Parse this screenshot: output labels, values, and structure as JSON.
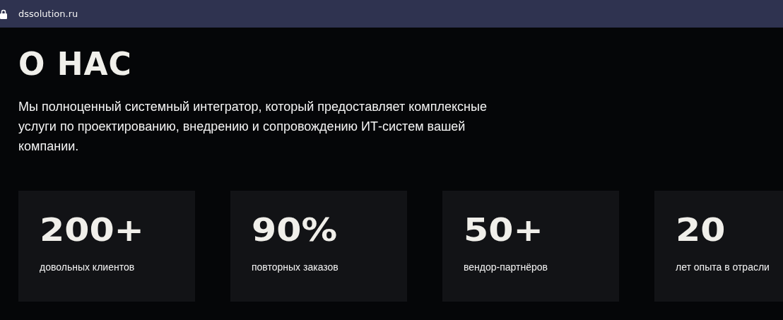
{
  "address_bar": {
    "url": "dssolution.ru"
  },
  "heading": "О НАС",
  "description": "Мы полноценный системный интегратор, который предоставляет комплексные услуги по проектированию, внедрению и сопровождению ИТ-систем вашей компании.",
  "stats": [
    {
      "value": "200+",
      "label": "довольных клиентов"
    },
    {
      "value": "90%",
      "label": "повторных заказов"
    },
    {
      "value": "50+",
      "label": "вендор-партнёров"
    },
    {
      "value": "20",
      "label": "лет опыта в отрасли"
    }
  ]
}
